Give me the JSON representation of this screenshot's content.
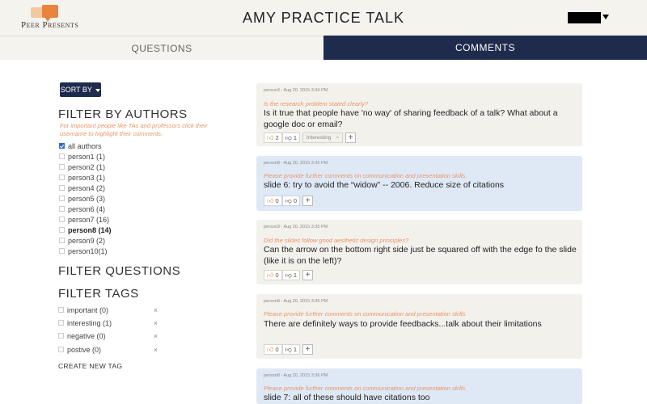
{
  "app": {
    "logo_text": "Peer Presents",
    "title": "AMY PRACTICE TALK"
  },
  "tabs": [
    {
      "label": "QUESTIONS"
    },
    {
      "label": "COMMENTS"
    }
  ],
  "sidebar": {
    "sort_label": "SORT BY",
    "filter_authors_title": "FILTER BY AUTHORS",
    "filter_authors_hint": "For important people like TAs and professors click their username to highlight their comments.",
    "authors": [
      {
        "label": "all authors",
        "checked": true
      },
      {
        "label": "person1 (1)"
      },
      {
        "label": "person2 (1)"
      },
      {
        "label": "person3 (1)"
      },
      {
        "label": "person4 (2)"
      },
      {
        "label": "person5 (3)"
      },
      {
        "label": "person6 (4)"
      },
      {
        "label": "person7 (16)"
      },
      {
        "label": "person8 (14)",
        "bold": true
      },
      {
        "label": "person9 (2)"
      },
      {
        "label": "person10(1)"
      }
    ],
    "filter_questions_title": "FILTER QUESTIONS",
    "filter_tags_title": "FILTER TAGS",
    "tags": [
      {
        "label": "important (0)",
        "remove": "×"
      },
      {
        "label": "interesting (1)",
        "remove": "×"
      },
      {
        "label": "negative (0)",
        "remove": "×"
      },
      {
        "label": "postive (0)",
        "remove": "×"
      }
    ],
    "create_tag_label": "CREATE NEW TAG"
  },
  "comments": [
    {
      "meta": "person3 - Aug 20, 2015 3:34 PM",
      "question": "Is the research problem stated clearly?",
      "text": "Is it true that people have 'no way' of sharing feedback of a talk? What about a google doc or email?",
      "up": "2",
      "down": "1",
      "tag": "Interesting",
      "tag_remove": "×",
      "add": "+"
    },
    {
      "meta": "person8 - Aug 20, 2015 3:35 PM",
      "question": "Please provide further comments on communication and presentation skills.",
      "text": "slide 6: try to avoid the “widow” -- 2006. Reduce size of citations",
      "up": "0",
      "down": "0",
      "add": "+"
    },
    {
      "meta": "person3 - Aug 20, 2015 3:35 PM",
      "question": "Did the slides follow good aesthetic design principles?",
      "text": "Can the arrow on the bottom right side just be squared off with the edge fo the slide (like it is on the left)?",
      "up": "0",
      "down": "1",
      "add": "+"
    },
    {
      "meta": "person8 - Aug 20, 2015 3:35 PM",
      "question": "Please provide further comments on communication and presentation skills.",
      "text": "There are definitely ways to provide feedbacks...talk about their limitations",
      "up": "0",
      "down": "1",
      "add": "+"
    },
    {
      "meta": "person8 - Aug 20, 2015 3:36 PM",
      "question": "Please provide further comments on communication and presentation skills.",
      "text": "slide 7: all of these should have citations too"
    }
  ],
  "colors": {
    "navy": "#1e2b4c",
    "accent_orange": "#e8956b",
    "card_beige": "#f3f1ec",
    "card_blue": "#dfe9f5"
  }
}
